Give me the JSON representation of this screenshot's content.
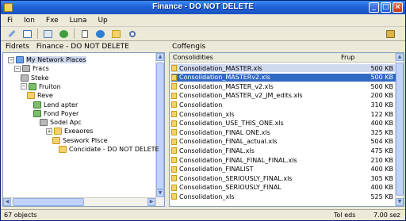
{
  "window": {
    "title": "Finance - DO NOT DELETE"
  },
  "menu": [
    {
      "label": "Fi"
    },
    {
      "label": "Ion"
    },
    {
      "label": "Fxe"
    },
    {
      "label": "Luna"
    },
    {
      "label": "Up"
    }
  ],
  "left_header": {
    "label": "Fidrets",
    "path": "Finance - DO NOT DELETE"
  },
  "right_header": {
    "label": "Coffengis"
  },
  "tree": [
    {
      "label": "My Network Places",
      "icon": "network-icon",
      "expander": "-",
      "selected": true
    },
    {
      "label": "Fracs",
      "icon": "server-icon",
      "expander": "-"
    },
    {
      "label": "Steke",
      "icon": "server-icon",
      "expander": ""
    },
    {
      "label": "Fruiton",
      "icon": "share-icon",
      "expander": "-"
    },
    {
      "label": "Reve",
      "icon": "folder-icon",
      "expander": ""
    },
    {
      "label": "Lend apter",
      "icon": "share-icon",
      "expander": ""
    },
    {
      "label": "Fond Poyer",
      "icon": "share-icon",
      "expander": ""
    },
    {
      "label": "Sodel Apc",
      "icon": "server-icon",
      "expander": ""
    },
    {
      "label": "Exeaores",
      "icon": "folder-icon",
      "expander": "+"
    },
    {
      "label": "Seswork Plsce",
      "icon": "folder-icon",
      "expander": ""
    },
    {
      "label": "Concidate - DO NOT DELETE",
      "icon": "folder-icon",
      "expander": ""
    }
  ],
  "columns": {
    "name": "Consolidities",
    "size": "Frup"
  },
  "files": [
    {
      "name": "Consolidation_MASTER.xls",
      "size": "500 KB",
      "state": "selected"
    },
    {
      "name": "Consolidation_MASTERv2.xls",
      "size": "500 KB",
      "state": "highlight"
    },
    {
      "name": "Consolidation_MASTER_v2.xls",
      "size": "500 KB",
      "state": ""
    },
    {
      "name": "Consolidation_MASTER_v2_JM_edits.xls",
      "size": "200 KB",
      "state": ""
    },
    {
      "name": "Consolidation",
      "size": "310 KB",
      "state": ""
    },
    {
      "name": "Consolidation_xls",
      "size": "122 KB",
      "state": ""
    },
    {
      "name": "Consolidation_USE_THIS_ONE.xls",
      "size": "400 KB",
      "state": ""
    },
    {
      "name": "Consolidation_FINAL ONE.xls",
      "size": "325 KB",
      "state": ""
    },
    {
      "name": "Consolidation_FINAL_actual.xls",
      "size": "504 KB",
      "state": ""
    },
    {
      "name": "Consolidation_FINAL.xls",
      "size": "475 KB",
      "state": ""
    },
    {
      "name": "Consolidation_FINAL_FINAL_FINAL.xls",
      "size": "210 KB",
      "state": ""
    },
    {
      "name": "Consolidation_FINALIST",
      "size": "400 KB",
      "state": ""
    },
    {
      "name": "Consolidation_SERIOUSLY_FINAL.xls",
      "size": "305 KB",
      "state": ""
    },
    {
      "name": "Consolidation_SERIOUSLY_FINAL",
      "size": "400 KB",
      "state": ""
    },
    {
      "name": "Consolidation_xls",
      "size": "525 KB",
      "state": ""
    }
  ],
  "status": {
    "left": "67 objects",
    "mid": "Tol eds",
    "right": "7.00 sez"
  },
  "colors": {
    "title_bar": "#1f62d7",
    "selection": "#316ac5",
    "folder": "#f3d16b"
  }
}
